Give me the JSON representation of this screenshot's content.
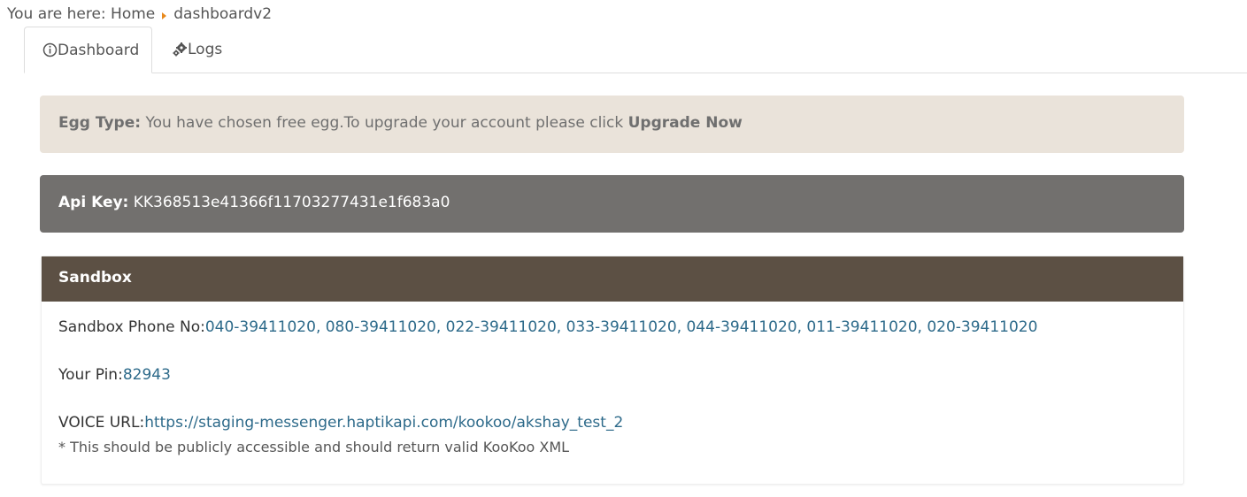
{
  "breadcrumb": {
    "prefix": "You are here:",
    "home": "Home",
    "current": "dashboardv2"
  },
  "tabs": [
    {
      "label": "Dashboard",
      "icon": "info-circle-icon",
      "active": true
    },
    {
      "label": "Logs",
      "icon": "gears-icon",
      "active": false
    }
  ],
  "egg": {
    "label": "Egg Type:",
    "message": "You have chosen free egg.To upgrade your account please click",
    "upgrade_link": "Upgrade Now"
  },
  "api": {
    "label": "Api Key:",
    "value": "KK368513e41366f11703277431e1f683a0"
  },
  "sandbox": {
    "title": "Sandbox",
    "phone_label": "Sandbox Phone No:",
    "phone_numbers": "040-39411020, 080-39411020, 022-39411020, 033-39411020, 044-39411020, 011-39411020, 020-39411020",
    "pin_label": "Your Pin:",
    "pin_value": "82943",
    "voice_label": "VOICE URL:",
    "voice_url": "https://staging-messenger.haptikapi.com/kookoo/akshay_test_2",
    "note": "* This should be publicly accessible and should return valid KooKoo XML"
  },
  "colors": {
    "egg_bg": "#eae3da",
    "api_bg": "#72706e",
    "sandbox_header_bg": "#5c5044",
    "link": "#2d6a8a",
    "breadcrumb_arrow": "#e8891c"
  }
}
